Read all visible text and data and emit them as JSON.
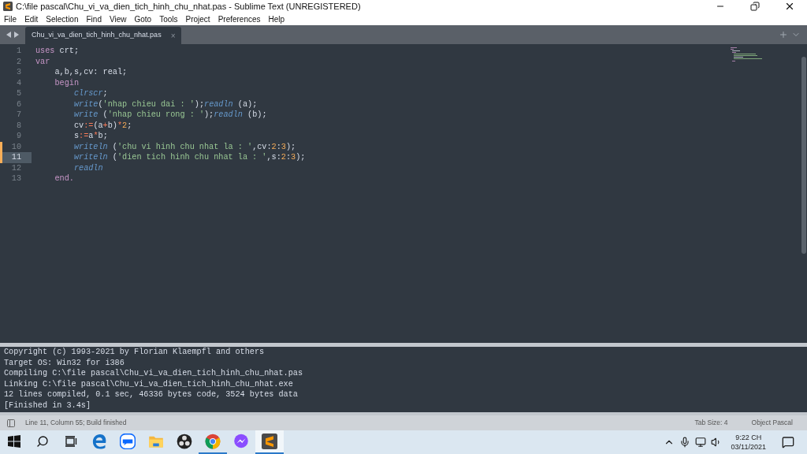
{
  "window": {
    "title": "C:\\file pascal\\Chu_vi_va_dien_tich_hinh_chu_nhat.pas - Sublime Text (UNREGISTERED)"
  },
  "menu": [
    "File",
    "Edit",
    "Selection",
    "Find",
    "View",
    "Goto",
    "Tools",
    "Project",
    "Preferences",
    "Help"
  ],
  "tabs": [
    {
      "label": "Chu_vi_va_dien_tich_hinh_chu_nhat.pas",
      "selected": true,
      "close": "×"
    }
  ],
  "editor": {
    "lines": [
      {
        "number": "1",
        "modified": false,
        "selected": false,
        "tokens": [
          {
            "text": "uses",
            "kind": "keyword"
          },
          {
            "text": " crt;",
            "kind": "plain"
          }
        ]
      },
      {
        "number": "2",
        "modified": false,
        "selected": false,
        "tokens": [
          {
            "text": "var",
            "kind": "keyword"
          }
        ]
      },
      {
        "number": "3",
        "modified": false,
        "selected": false,
        "tokens": [
          {
            "text": "    a,b,s,cv: real;",
            "kind": "plain"
          }
        ]
      },
      {
        "number": "4",
        "modified": false,
        "selected": false,
        "tokens": [
          {
            "text": "    begin",
            "kind": "keyword"
          }
        ]
      },
      {
        "number": "5",
        "modified": false,
        "selected": false,
        "tokens": [
          {
            "text": "        clrscr",
            "kind": "function"
          },
          {
            "text": ";",
            "kind": "plain"
          }
        ]
      },
      {
        "number": "6",
        "modified": false,
        "selected": false,
        "tokens": [
          {
            "text": "        write",
            "kind": "function"
          },
          {
            "text": "(",
            "kind": "plain"
          },
          {
            "text": "'nhap chieu dai : '",
            "kind": "string"
          },
          {
            "text": ");",
            "kind": "plain"
          },
          {
            "text": "readln",
            "kind": "function"
          },
          {
            "text": " (a);",
            "kind": "plain"
          }
        ]
      },
      {
        "number": "7",
        "modified": false,
        "selected": false,
        "tokens": [
          {
            "text": "        write",
            "kind": "function"
          },
          {
            "text": " (",
            "kind": "plain"
          },
          {
            "text": "'nhap chieu rong : '",
            "kind": "string"
          },
          {
            "text": ");",
            "kind": "plain"
          },
          {
            "text": "readln",
            "kind": "function"
          },
          {
            "text": " (b);",
            "kind": "plain"
          }
        ]
      },
      {
        "number": "8",
        "modified": false,
        "selected": false,
        "tokens": [
          {
            "text": "        cv",
            "kind": "plain"
          },
          {
            "text": ":=",
            "kind": "operator"
          },
          {
            "text": "(a",
            "kind": "plain"
          },
          {
            "text": "+",
            "kind": "operator"
          },
          {
            "text": "b)",
            "kind": "plain"
          },
          {
            "text": "*",
            "kind": "operator"
          },
          {
            "text": "2",
            "kind": "number"
          },
          {
            "text": ";",
            "kind": "plain"
          }
        ]
      },
      {
        "number": "9",
        "modified": false,
        "selected": false,
        "tokens": [
          {
            "text": "        s",
            "kind": "plain"
          },
          {
            "text": ":=",
            "kind": "operator"
          },
          {
            "text": "a",
            "kind": "plain"
          },
          {
            "text": "*",
            "kind": "operator"
          },
          {
            "text": "b;",
            "kind": "plain"
          }
        ]
      },
      {
        "number": "10",
        "modified": true,
        "selected": false,
        "tokens": [
          {
            "text": "        writeln",
            "kind": "function"
          },
          {
            "text": " (",
            "kind": "plain"
          },
          {
            "text": "'chu vi hinh chu nhat la : '",
            "kind": "string"
          },
          {
            "text": ",cv:",
            "kind": "plain"
          },
          {
            "text": "2",
            "kind": "number"
          },
          {
            "text": ":",
            "kind": "plain"
          },
          {
            "text": "3",
            "kind": "number"
          },
          {
            "text": ");",
            "kind": "plain"
          }
        ]
      },
      {
        "number": "11",
        "modified": true,
        "selected": true,
        "tokens": [
          {
            "text": "        writeln",
            "kind": "function"
          },
          {
            "text": " (",
            "kind": "plain"
          },
          {
            "text": "'dien tich hinh chu nhat la : '",
            "kind": "string"
          },
          {
            "text": ",s:",
            "kind": "plain"
          },
          {
            "text": "2",
            "kind": "number"
          },
          {
            "text": ":",
            "kind": "plain"
          },
          {
            "text": "3",
            "kind": "number"
          },
          {
            "text": ");",
            "kind": "plain"
          }
        ]
      },
      {
        "number": "12",
        "modified": false,
        "selected": false,
        "tokens": [
          {
            "text": "        readln",
            "kind": "function"
          }
        ]
      },
      {
        "number": "13",
        "modified": false,
        "selected": false,
        "tokens": [
          {
            "text": "    end.",
            "kind": "keyword"
          }
        ]
      }
    ]
  },
  "output": {
    "lines": [
      "Copyright (c) 1993-2021 by Florian Klaempfl and others",
      "Target OS: Win32 for i386",
      "Compiling C:\\file pascal\\Chu_vi_va_dien_tich_hinh_chu_nhat.pas",
      "Linking C:\\file pascal\\Chu_vi_va_dien_tich_hinh_chu_nhat.exe",
      "12 lines compiled, 0.1 sec, 46336 bytes code, 3524 bytes data",
      "[Finished in 3.4s]"
    ]
  },
  "status_bar": {
    "message": "Line 11, Column 55; Build finished",
    "tab_size": "Tab Size: 4",
    "syntax": "Object Pascal"
  },
  "taskbar": {
    "items": [
      {
        "kind": "start",
        "running": false,
        "selected": false
      },
      {
        "kind": "search",
        "running": false,
        "selected": false
      },
      {
        "kind": "taskview",
        "running": false,
        "selected": false
      },
      {
        "kind": "edge",
        "running": false,
        "selected": false
      },
      {
        "kind": "zalo",
        "running": false,
        "selected": false
      },
      {
        "kind": "folder",
        "running": false,
        "selected": false
      },
      {
        "kind": "obs",
        "running": false,
        "selected": false
      },
      {
        "kind": "chrome",
        "running": true,
        "selected": false
      },
      {
        "kind": "messenger",
        "running": false,
        "selected": false
      },
      {
        "kind": "sublime",
        "running": true,
        "selected": true
      }
    ],
    "time": "9:22 CH",
    "date": "03/11/2021"
  }
}
